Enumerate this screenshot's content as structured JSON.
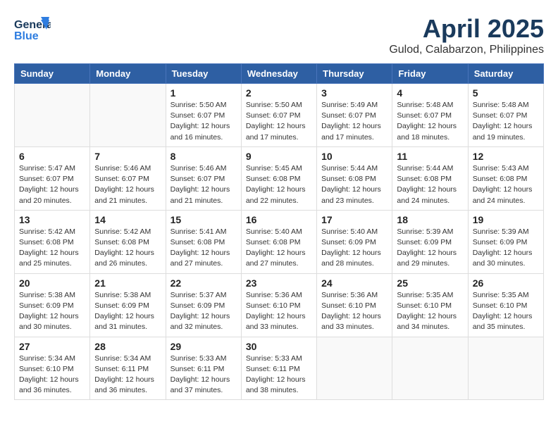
{
  "header": {
    "logo_line1": "General",
    "logo_line2": "Blue",
    "month": "April 2025",
    "location": "Gulod, Calabarzon, Philippines"
  },
  "weekdays": [
    "Sunday",
    "Monday",
    "Tuesday",
    "Wednesday",
    "Thursday",
    "Friday",
    "Saturday"
  ],
  "weeks": [
    [
      {
        "day": "",
        "info": ""
      },
      {
        "day": "",
        "info": ""
      },
      {
        "day": "1",
        "info": "Sunrise: 5:50 AM\nSunset: 6:07 PM\nDaylight: 12 hours\nand 16 minutes."
      },
      {
        "day": "2",
        "info": "Sunrise: 5:50 AM\nSunset: 6:07 PM\nDaylight: 12 hours\nand 17 minutes."
      },
      {
        "day": "3",
        "info": "Sunrise: 5:49 AM\nSunset: 6:07 PM\nDaylight: 12 hours\nand 17 minutes."
      },
      {
        "day": "4",
        "info": "Sunrise: 5:48 AM\nSunset: 6:07 PM\nDaylight: 12 hours\nand 18 minutes."
      },
      {
        "day": "5",
        "info": "Sunrise: 5:48 AM\nSunset: 6:07 PM\nDaylight: 12 hours\nand 19 minutes."
      }
    ],
    [
      {
        "day": "6",
        "info": "Sunrise: 5:47 AM\nSunset: 6:07 PM\nDaylight: 12 hours\nand 20 minutes."
      },
      {
        "day": "7",
        "info": "Sunrise: 5:46 AM\nSunset: 6:07 PM\nDaylight: 12 hours\nand 21 minutes."
      },
      {
        "day": "8",
        "info": "Sunrise: 5:46 AM\nSunset: 6:07 PM\nDaylight: 12 hours\nand 21 minutes."
      },
      {
        "day": "9",
        "info": "Sunrise: 5:45 AM\nSunset: 6:08 PM\nDaylight: 12 hours\nand 22 minutes."
      },
      {
        "day": "10",
        "info": "Sunrise: 5:44 AM\nSunset: 6:08 PM\nDaylight: 12 hours\nand 23 minutes."
      },
      {
        "day": "11",
        "info": "Sunrise: 5:44 AM\nSunset: 6:08 PM\nDaylight: 12 hours\nand 24 minutes."
      },
      {
        "day": "12",
        "info": "Sunrise: 5:43 AM\nSunset: 6:08 PM\nDaylight: 12 hours\nand 24 minutes."
      }
    ],
    [
      {
        "day": "13",
        "info": "Sunrise: 5:42 AM\nSunset: 6:08 PM\nDaylight: 12 hours\nand 25 minutes."
      },
      {
        "day": "14",
        "info": "Sunrise: 5:42 AM\nSunset: 6:08 PM\nDaylight: 12 hours\nand 26 minutes."
      },
      {
        "day": "15",
        "info": "Sunrise: 5:41 AM\nSunset: 6:08 PM\nDaylight: 12 hours\nand 27 minutes."
      },
      {
        "day": "16",
        "info": "Sunrise: 5:40 AM\nSunset: 6:08 PM\nDaylight: 12 hours\nand 27 minutes."
      },
      {
        "day": "17",
        "info": "Sunrise: 5:40 AM\nSunset: 6:09 PM\nDaylight: 12 hours\nand 28 minutes."
      },
      {
        "day": "18",
        "info": "Sunrise: 5:39 AM\nSunset: 6:09 PM\nDaylight: 12 hours\nand 29 minutes."
      },
      {
        "day": "19",
        "info": "Sunrise: 5:39 AM\nSunset: 6:09 PM\nDaylight: 12 hours\nand 30 minutes."
      }
    ],
    [
      {
        "day": "20",
        "info": "Sunrise: 5:38 AM\nSunset: 6:09 PM\nDaylight: 12 hours\nand 30 minutes."
      },
      {
        "day": "21",
        "info": "Sunrise: 5:38 AM\nSunset: 6:09 PM\nDaylight: 12 hours\nand 31 minutes."
      },
      {
        "day": "22",
        "info": "Sunrise: 5:37 AM\nSunset: 6:09 PM\nDaylight: 12 hours\nand 32 minutes."
      },
      {
        "day": "23",
        "info": "Sunrise: 5:36 AM\nSunset: 6:10 PM\nDaylight: 12 hours\nand 33 minutes."
      },
      {
        "day": "24",
        "info": "Sunrise: 5:36 AM\nSunset: 6:10 PM\nDaylight: 12 hours\nand 33 minutes."
      },
      {
        "day": "25",
        "info": "Sunrise: 5:35 AM\nSunset: 6:10 PM\nDaylight: 12 hours\nand 34 minutes."
      },
      {
        "day": "26",
        "info": "Sunrise: 5:35 AM\nSunset: 6:10 PM\nDaylight: 12 hours\nand 35 minutes."
      }
    ],
    [
      {
        "day": "27",
        "info": "Sunrise: 5:34 AM\nSunset: 6:10 PM\nDaylight: 12 hours\nand 36 minutes."
      },
      {
        "day": "28",
        "info": "Sunrise: 5:34 AM\nSunset: 6:11 PM\nDaylight: 12 hours\nand 36 minutes."
      },
      {
        "day": "29",
        "info": "Sunrise: 5:33 AM\nSunset: 6:11 PM\nDaylight: 12 hours\nand 37 minutes."
      },
      {
        "day": "30",
        "info": "Sunrise: 5:33 AM\nSunset: 6:11 PM\nDaylight: 12 hours\nand 38 minutes."
      },
      {
        "day": "",
        "info": ""
      },
      {
        "day": "",
        "info": ""
      },
      {
        "day": "",
        "info": ""
      }
    ]
  ]
}
